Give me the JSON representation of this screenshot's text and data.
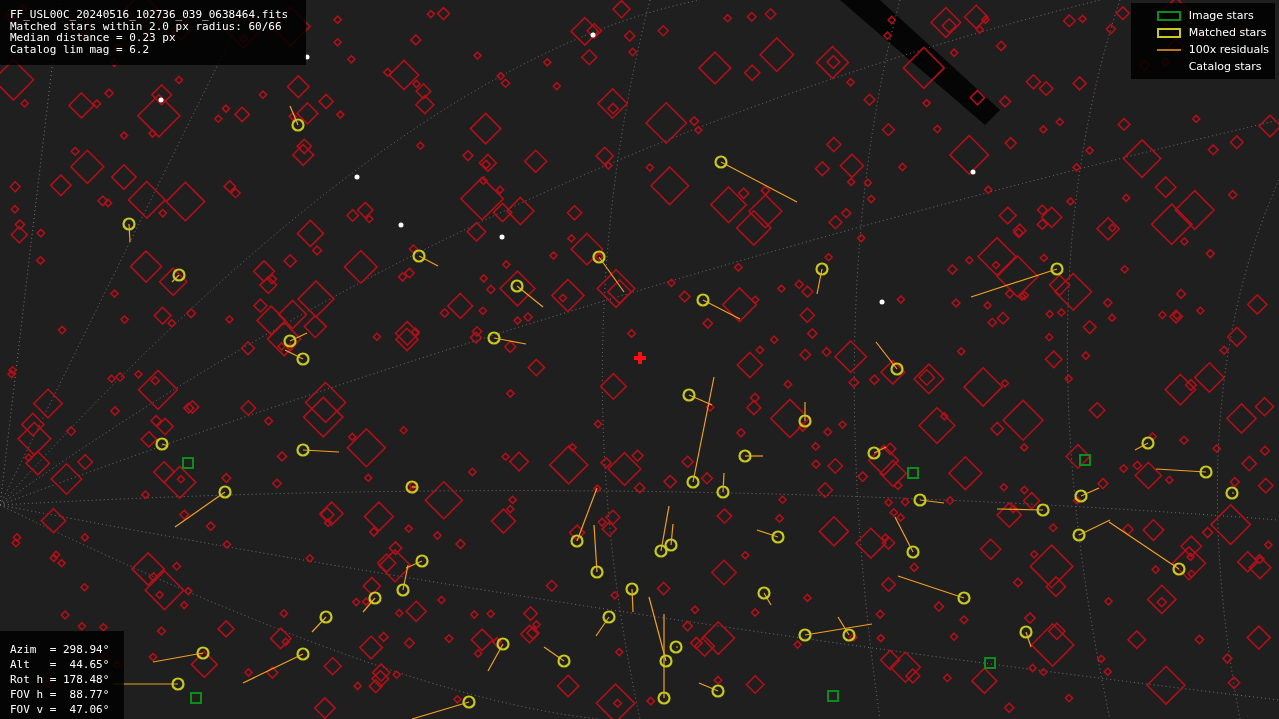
{
  "info_lines": [
    "FF_USL00C_20240516_102736_039_0638464.fits",
    "Matched stars within 2.0 px radius: 60/66",
    "Median distance = 0.23 px",
    "Catalog lim mag = 6.2"
  ],
  "legend": [
    {
      "kind": "image",
      "label": "Image stars"
    },
    {
      "kind": "matched",
      "label": "Matched stars"
    },
    {
      "kind": "residual",
      "label": "100x residuals"
    },
    {
      "kind": "catalog",
      "label": "Catalog stars"
    }
  ],
  "pointing_lines": [
    "Azim  = 298.94°",
    "Alt   =  44.65°",
    "Rot h = 178.48°",
    "FOV h =  88.77°",
    "FOV v =  47.06°"
  ]
}
